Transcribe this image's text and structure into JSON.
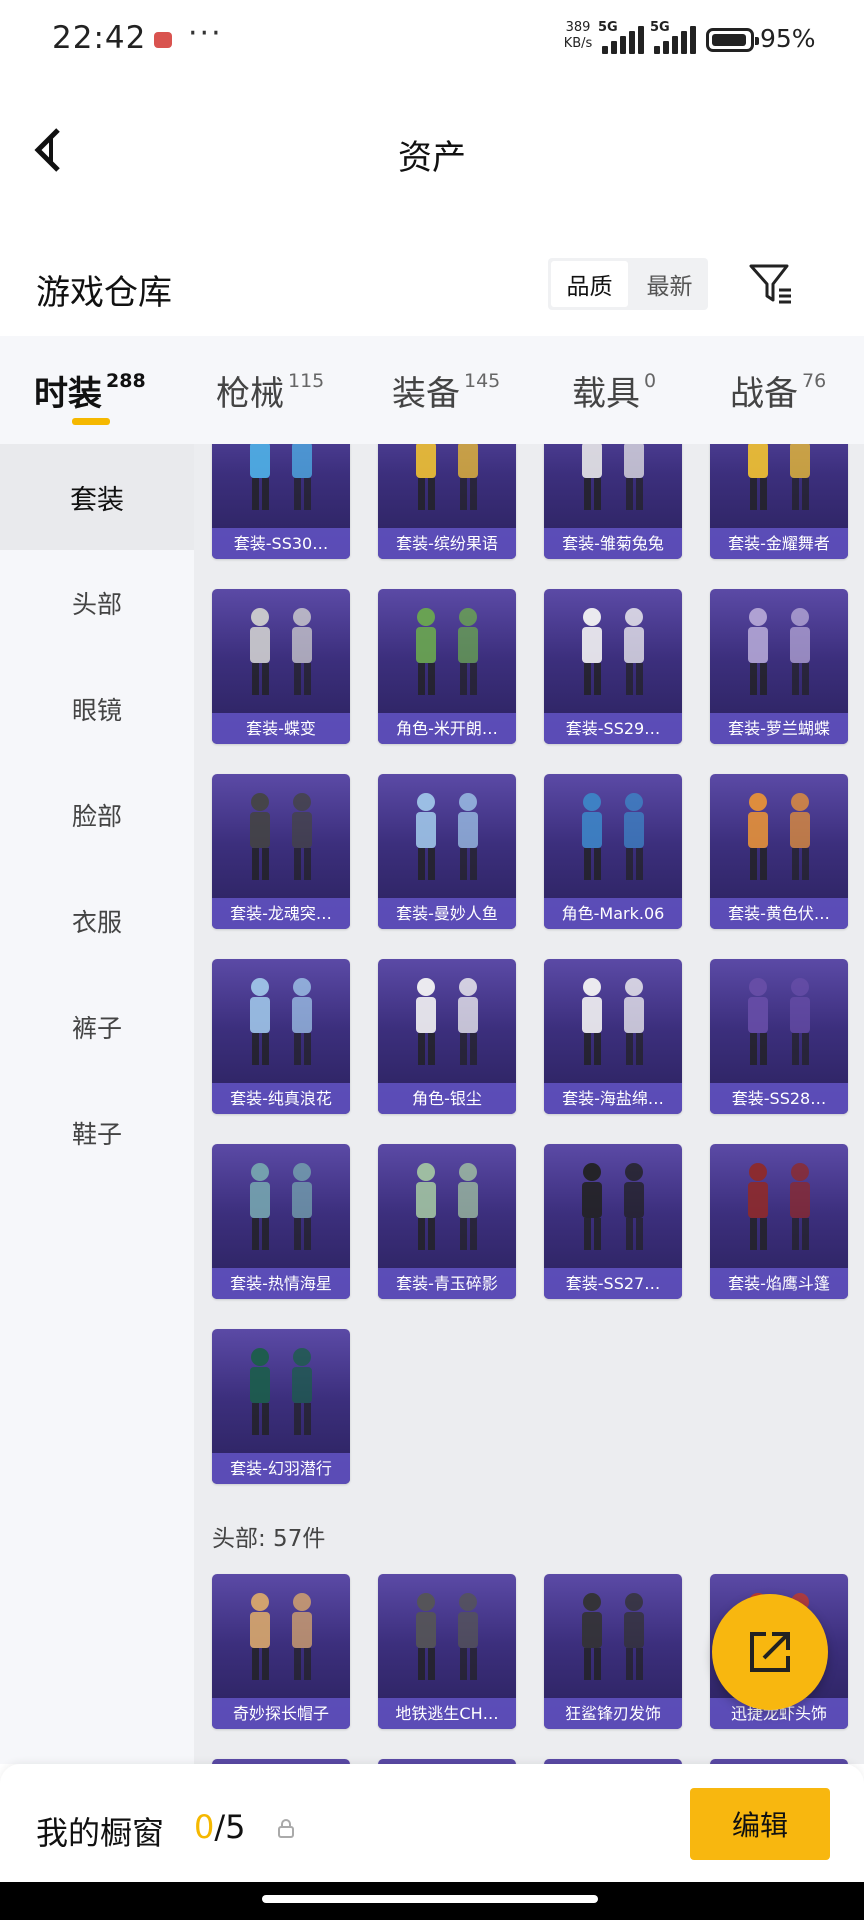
{
  "status_bar": {
    "time": "22:42",
    "net_speed_value": "389",
    "net_speed_unit": "KB/s",
    "sim1_label": "5G",
    "sim2_label": "5G",
    "battery_percent": "95%",
    "battery_level": 0.95
  },
  "nav": {
    "title": "资产"
  },
  "warehouse": {
    "title": "游戏仓库",
    "sort_options": [
      "品质",
      "最新"
    ],
    "sort_selected": "品质"
  },
  "tabs": [
    {
      "label": "时装",
      "count": "288",
      "active": true
    },
    {
      "label": "枪械",
      "count": "115",
      "active": false
    },
    {
      "label": "装备",
      "count": "145",
      "active": false
    },
    {
      "label": "载具",
      "count": "0",
      "active": false
    },
    {
      "label": "战备",
      "count": "76",
      "active": false
    }
  ],
  "sidebar": {
    "items": [
      {
        "label": "套装",
        "active": true
      },
      {
        "label": "头部",
        "active": false
      },
      {
        "label": "眼镜",
        "active": false
      },
      {
        "label": "脸部",
        "active": false
      },
      {
        "label": "衣服",
        "active": false
      },
      {
        "label": "裤子",
        "active": false
      },
      {
        "label": "鞋子",
        "active": false
      }
    ]
  },
  "suit_items": [
    "套装-SS30…",
    "套装-缤纷果语",
    "套装-雏菊兔兔",
    "套装-金耀舞者",
    "套装-蝶变",
    "角色-米开朗…",
    "套装-SS29…",
    "套装-萝兰蝴蝶",
    "套装-龙魂突…",
    "套装-曼妙人鱼",
    "角色-Mark.06",
    "套装-黄色伏…",
    "套装-纯真浪花",
    "角色-银尘",
    "套装-海盐绵…",
    "套装-SS28…",
    "套装-热情海星",
    "套装-青玉碎影",
    "套装-SS27…",
    "套装-焰鹰斗篷",
    "套装-幻羽潜行"
  ],
  "head_group_label": "头部: 57件",
  "head_items": [
    "奇妙探长帽子",
    "地铁逃生CH…",
    "狂鲨锋刃发饰",
    "迅捷龙虾头饰"
  ],
  "icons": {
    "back": "chevron-left-icon",
    "filter": "filter-icon",
    "fab": "share-external-icon",
    "lock": "lock-icon"
  },
  "colors": {
    "accent": "#f8b70f",
    "card_bg": "#3c2f7d",
    "card_label_bg": "#5f50be"
  },
  "bottom_bar": {
    "window_label": "我的橱窗",
    "window_current": "0",
    "window_total": "/5",
    "edit_label": "编辑"
  }
}
